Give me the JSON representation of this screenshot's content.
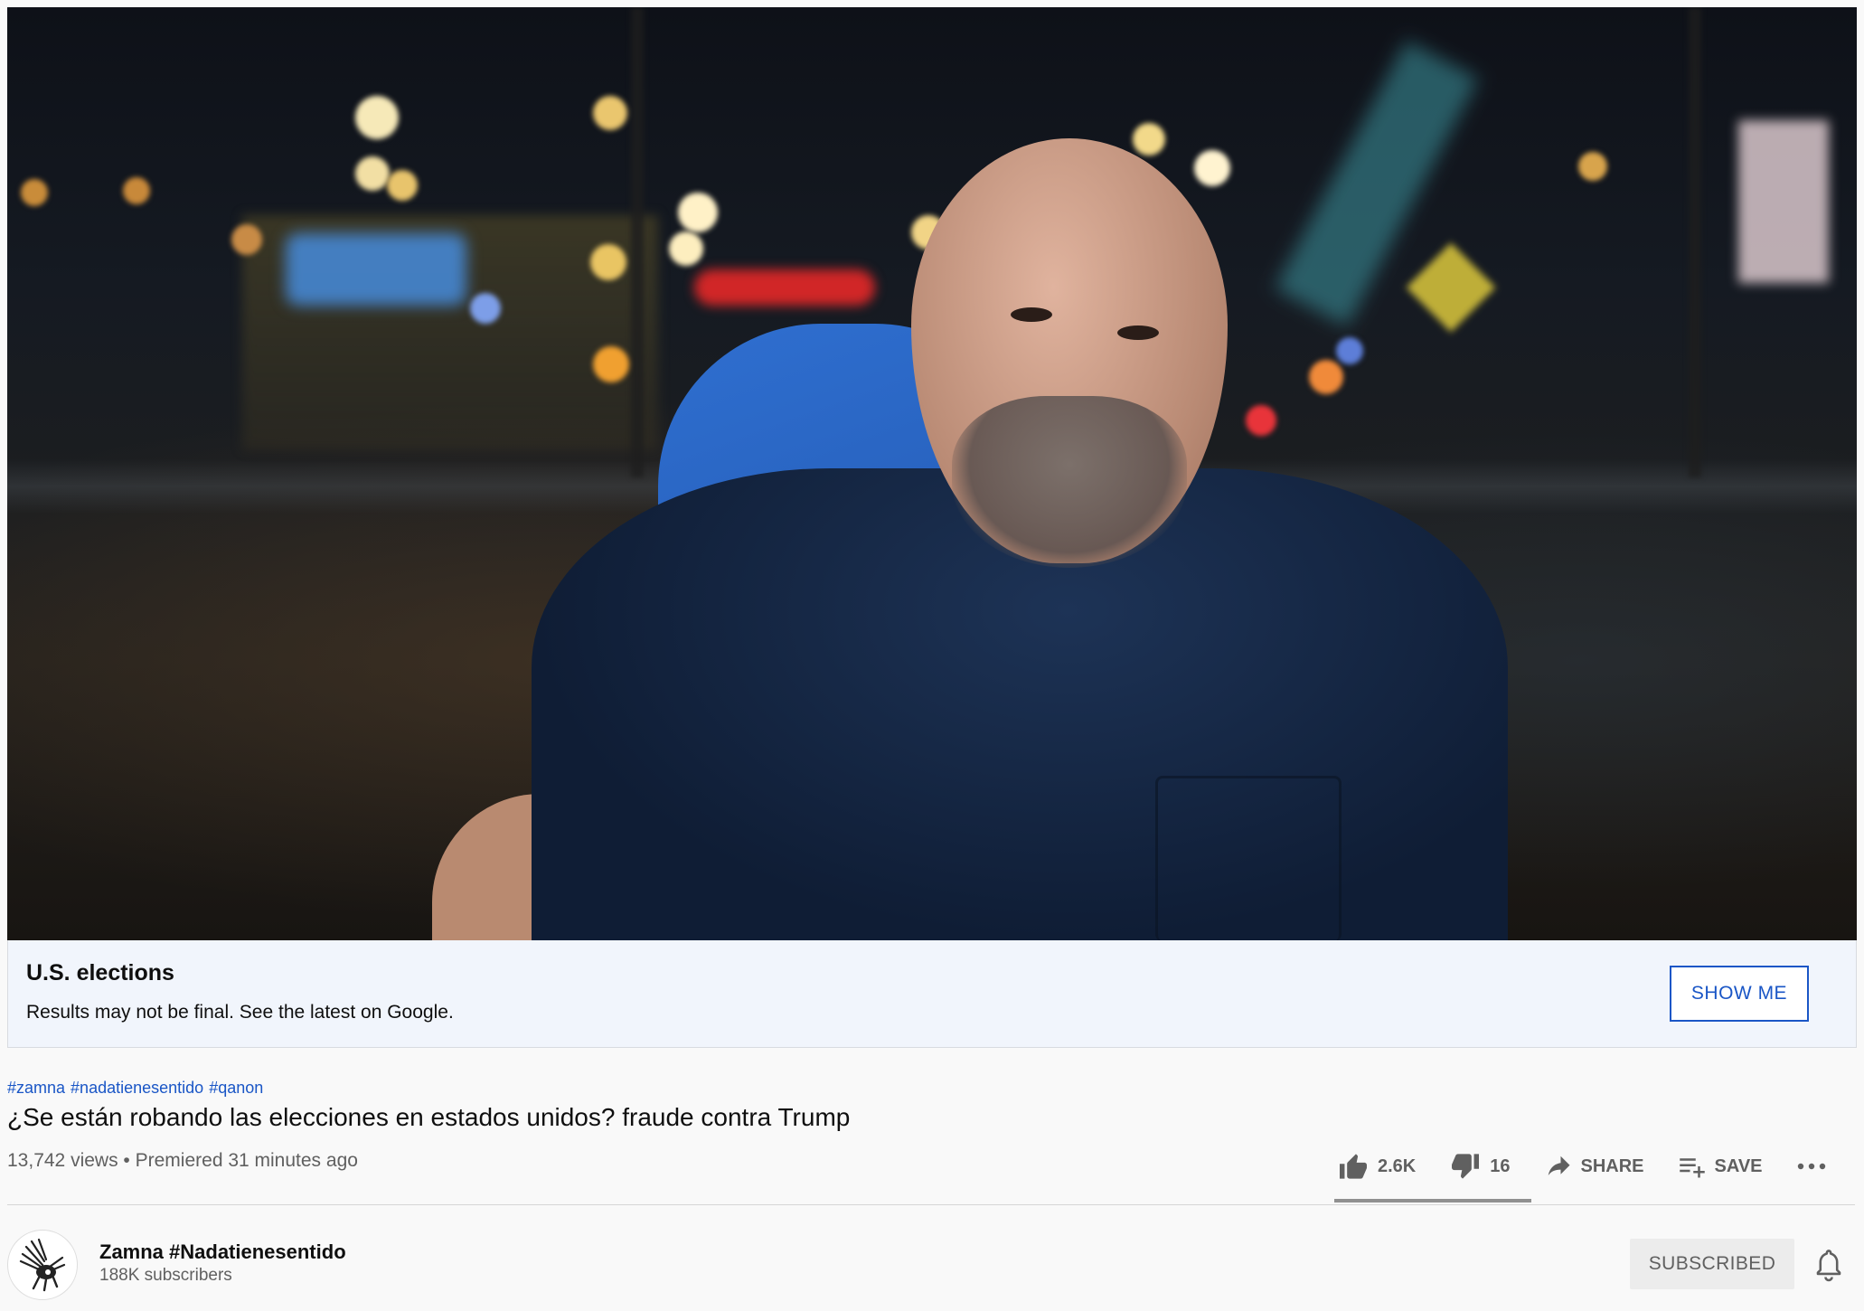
{
  "video": {
    "description_icon": "video-player"
  },
  "election_panel": {
    "title": "U.S. elections",
    "subtitle": "Results may not be final. See the latest on Google.",
    "button_label": "SHOW ME",
    "accent_color": "#1a56c6"
  },
  "video_info": {
    "hashtags": [
      "#zamna",
      "#nadatienesentido",
      "#qanon"
    ],
    "title": "¿Se están robando las elecciones en estados unidos? fraude contra Trump",
    "views": "13,742 views",
    "separator": "•",
    "premiered": "Premiered 31 minutes ago"
  },
  "actions": {
    "like_count": "2.6K",
    "dislike_count": "16",
    "share_label": "SHARE",
    "save_label": "SAVE",
    "like_icon": "thumbs-up-icon",
    "dislike_icon": "thumbs-down-icon",
    "share_icon": "share-arrow-icon",
    "save_icon": "playlist-add-icon",
    "more_icon": "more-horizontal-icon"
  },
  "channel": {
    "name": "Zamna #Nadatienesentido",
    "subscribers": "188K subscribers",
    "subscribe_state": "SUBSCRIBED",
    "avatar_icon": "bird-logo-icon",
    "bell_icon": "bell-icon"
  }
}
